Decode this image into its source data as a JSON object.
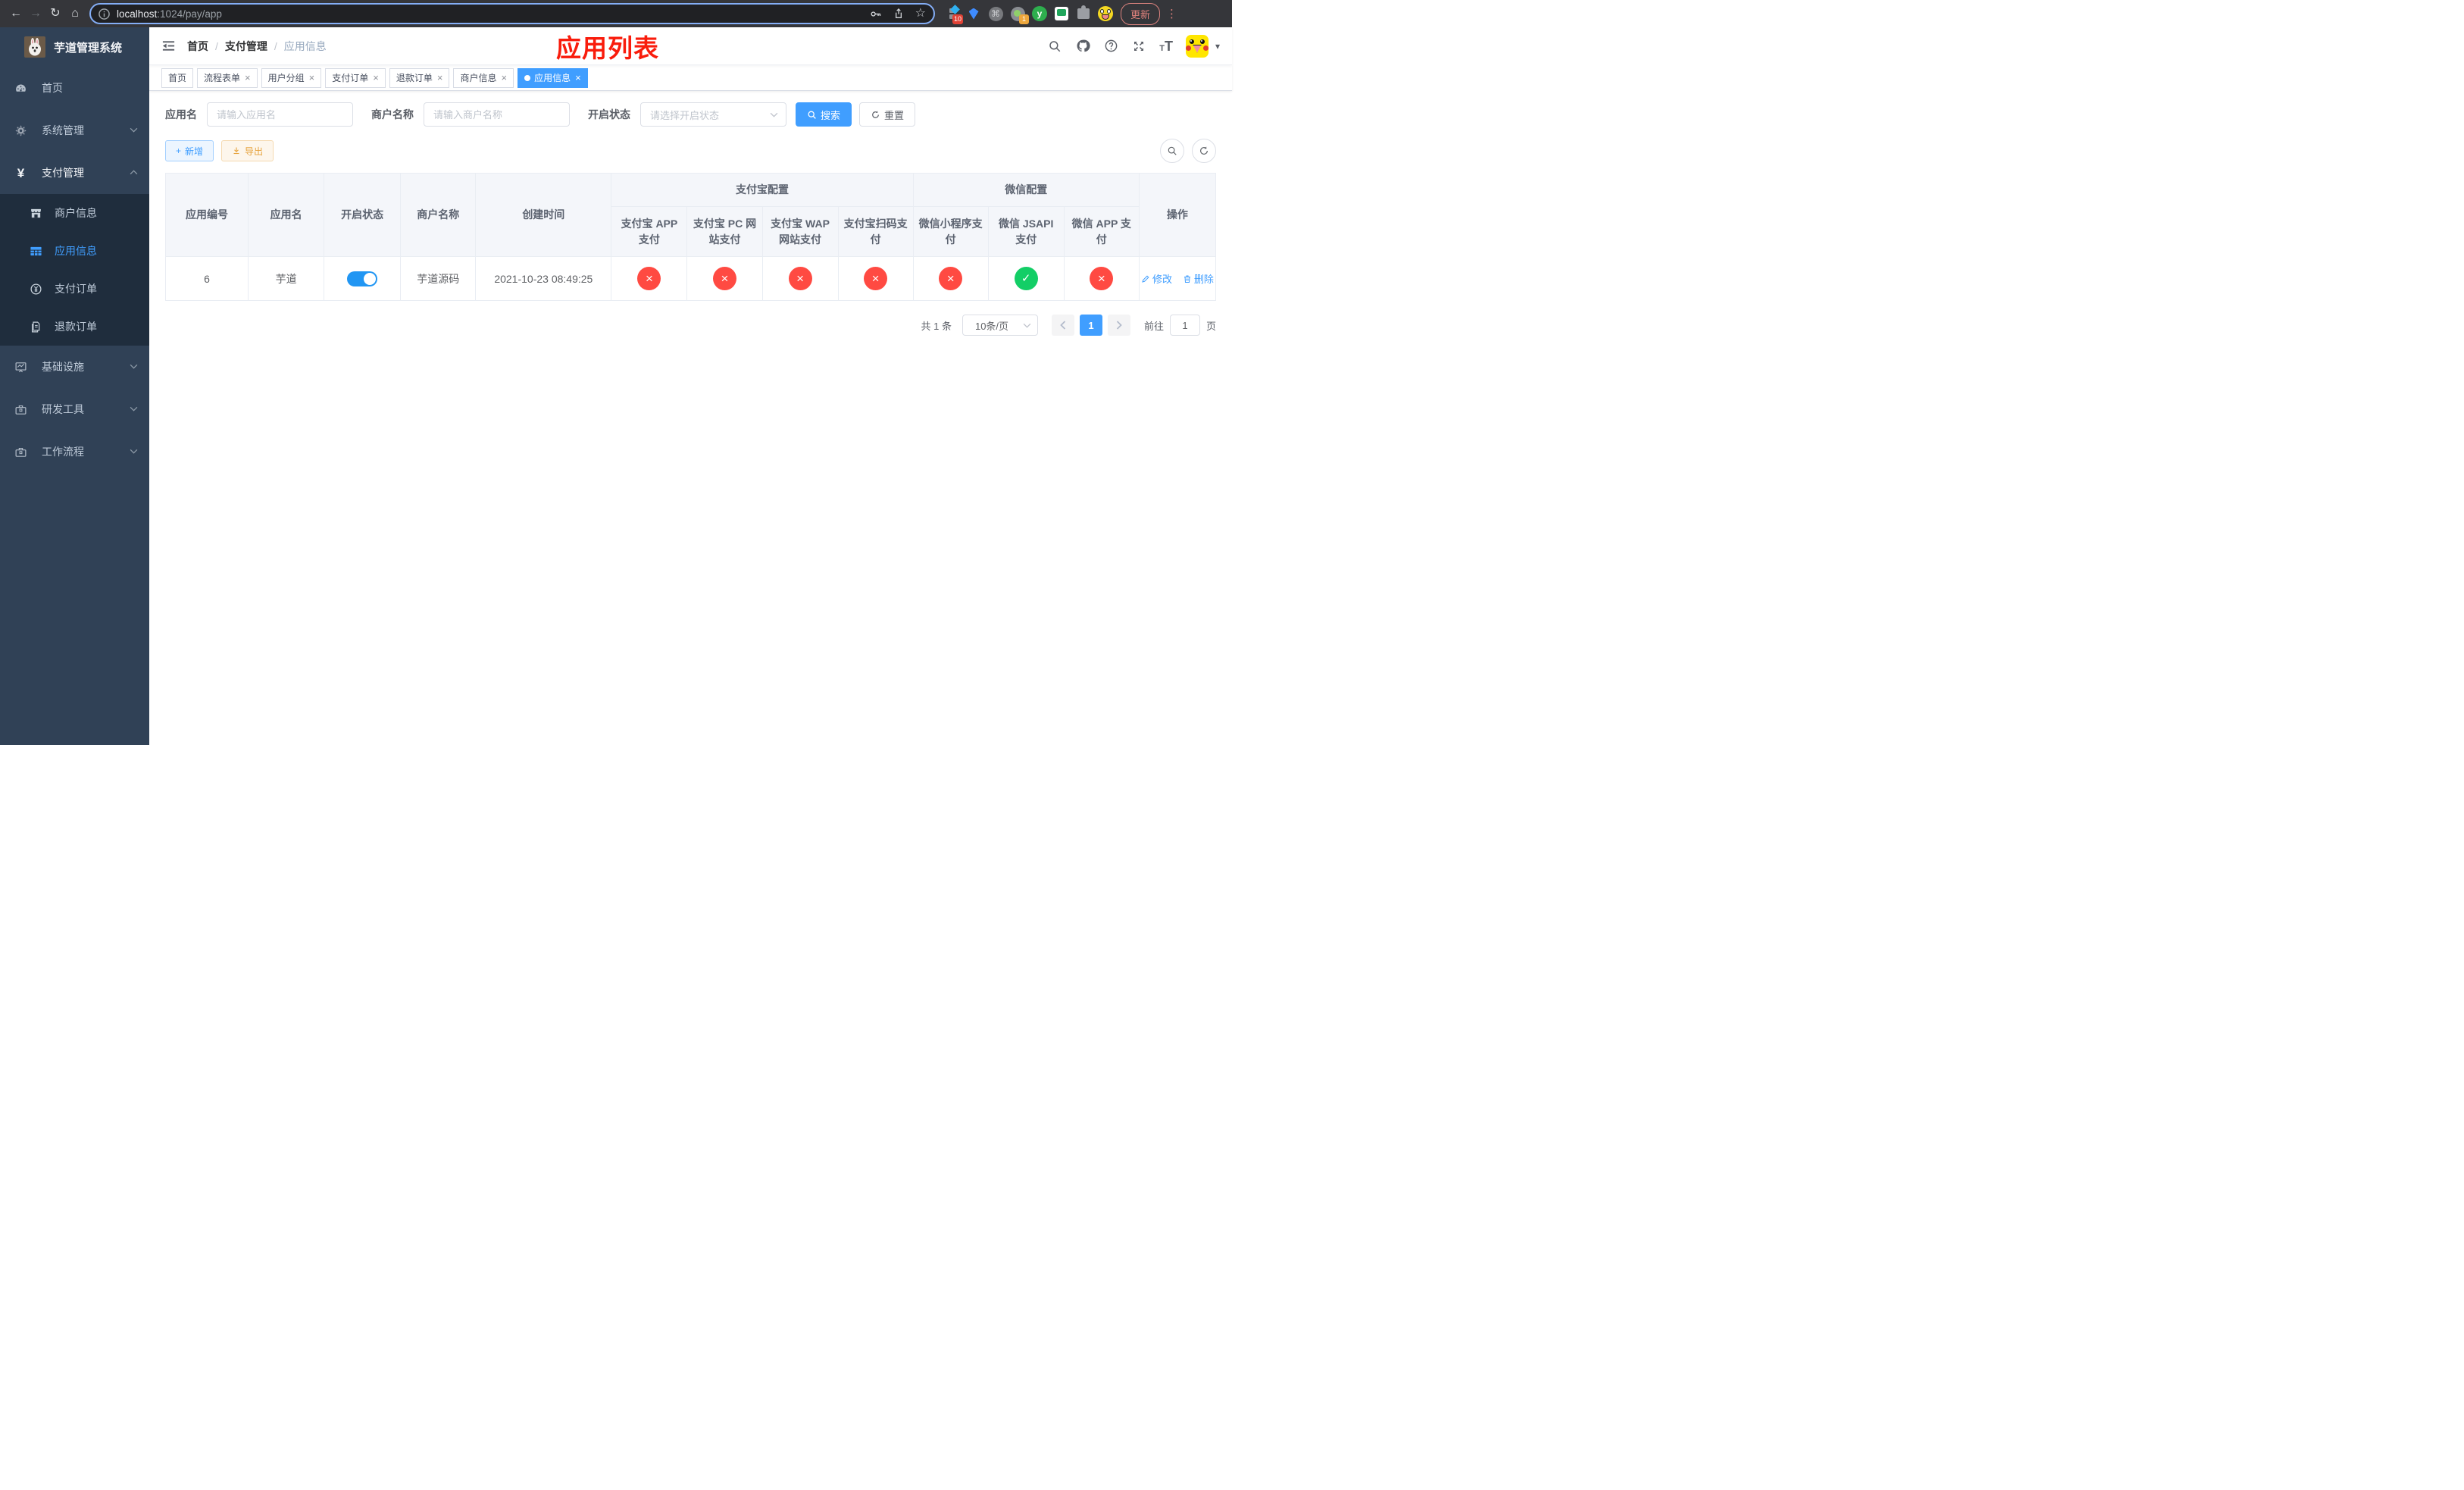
{
  "icons": {
    "back": "←",
    "forward": "→",
    "reload": "↻",
    "home": "⌂",
    "star": "☆",
    "menu_dots": "⋮",
    "command": "⌘",
    "ext_y": "y",
    "caret": "▾",
    "check": "✓",
    "cross": "×",
    "close": "×",
    "yen": "¥",
    "plus": "+",
    "ext_badge_diamond": "10",
    "ext_badge_circle": "1",
    "font_small": "T",
    "font_large": "T"
  },
  "browser": {
    "url_host": "localhost",
    "url_path": ":1024/pay/app",
    "update_label": "更新"
  },
  "sidebar": {
    "logo_title": "芋道管理系统",
    "items": [
      {
        "label": "首页"
      },
      {
        "label": "系统管理"
      },
      {
        "label": "支付管理"
      },
      {
        "label": "商户信息"
      },
      {
        "label": "应用信息"
      },
      {
        "label": "支付订单"
      },
      {
        "label": "退款订单"
      },
      {
        "label": "基础设施"
      },
      {
        "label": "研发工具"
      },
      {
        "label": "工作流程"
      }
    ]
  },
  "header": {
    "breadcrumb": [
      "首页",
      "支付管理",
      "应用信息"
    ],
    "separator": "/",
    "annotation": "应用列表"
  },
  "tabs": [
    {
      "label": "首页"
    },
    {
      "label": "流程表单"
    },
    {
      "label": "用户分组"
    },
    {
      "label": "支付订单"
    },
    {
      "label": "退款订单"
    },
    {
      "label": "商户信息"
    },
    {
      "label": "应用信息"
    }
  ],
  "filters": {
    "app_name_label": "应用名",
    "app_name_placeholder": "请输入应用名",
    "merchant_label": "商户名称",
    "merchant_placeholder": "请输入商户名称",
    "status_label": "开启状态",
    "status_placeholder": "请选择开启状态",
    "search_label": "搜索",
    "reset_label": "重置"
  },
  "toolbar": {
    "add_label": "新增",
    "export_label": "导出"
  },
  "table": {
    "headers": {
      "id": "应用编号",
      "name": "应用名",
      "enabled": "开启状态",
      "merchant": "商户名称",
      "created": "创建时间",
      "alipay_group": "支付宝配置",
      "wechat_group": "微信配置",
      "actions": "操作",
      "sub": [
        "支付宝 APP 支付",
        "支付宝 PC 网站支付",
        "支付宝 WAP 网站支付",
        "支付宝扫码支付",
        "微信小程序支付",
        "微信 JSAPI 支付",
        "微信 APP 支付"
      ]
    },
    "row": {
      "id": "6",
      "name": "芋道",
      "enabled": true,
      "merchant": "芋道源码",
      "created": "2021-10-23 08:49:25",
      "statuses": [
        false,
        false,
        false,
        false,
        false,
        true,
        false
      ],
      "edit_label": "修改",
      "delete_label": "删除"
    }
  },
  "pagination": {
    "total": "共 1 条",
    "page_size": "10条/页",
    "page": "1",
    "goto_label": "前往",
    "goto_value": "1",
    "unit_label": "页"
  },
  "colors": {
    "accent": "#409eff",
    "success": "#13ce66",
    "danger": "#ff4a42",
    "annotation": "#f91c0c",
    "sidebar_bg": "#304156",
    "submenu_bg": "#1f2d3d"
  }
}
